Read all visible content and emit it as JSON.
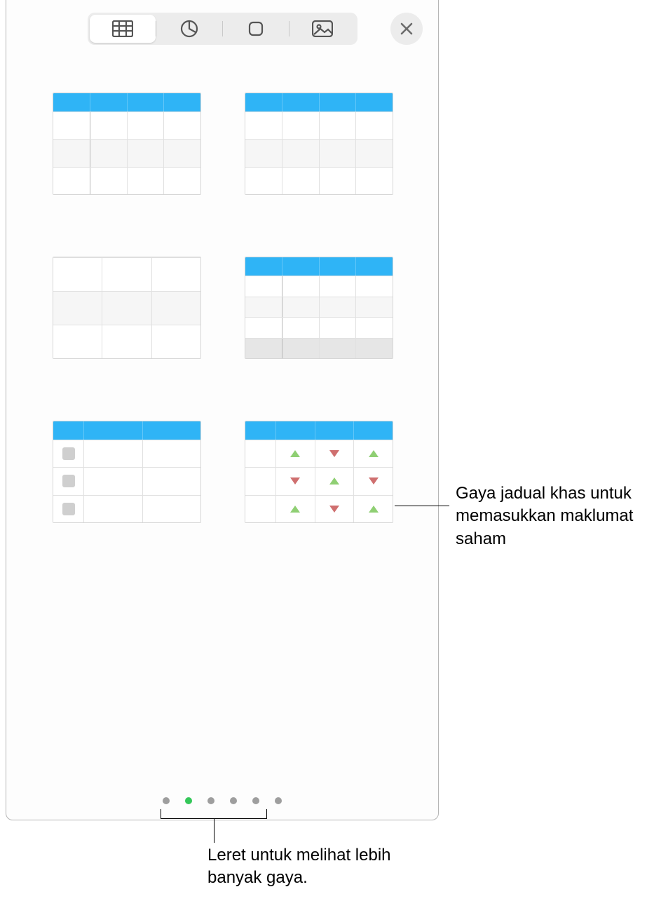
{
  "toolbar": {
    "tabs": [
      "table",
      "chart",
      "shape",
      "media"
    ],
    "active_tab_index": 0
  },
  "styles": [
    {
      "name": "table-style-header-firstcol",
      "has_header": true,
      "first_col_divider": true
    },
    {
      "name": "table-style-header-plain",
      "has_header": true,
      "first_col_divider": false
    },
    {
      "name": "table-style-plain",
      "has_header": false,
      "first_col_divider": false
    },
    {
      "name": "table-style-header-footer",
      "has_header": true,
      "first_col_divider": true,
      "footer": true
    },
    {
      "name": "table-style-checklist",
      "has_header": true,
      "checklist": true
    },
    {
      "name": "table-style-stock",
      "has_header": true,
      "stock": true
    }
  ],
  "pager": {
    "count": 6,
    "active_index": 1
  },
  "callouts": {
    "stock": "Gaya jadual khas untuk memasukkan maklumat saham",
    "pager": "Leret untuk melihat lebih banyak gaya."
  },
  "colors": {
    "header": "#2fb4f6",
    "dot_active": "#34c759",
    "tri_up": "#8fcf73",
    "tri_down": "#cf6f6f"
  }
}
